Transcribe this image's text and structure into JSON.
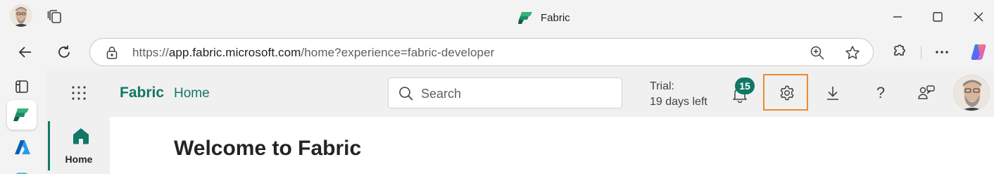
{
  "window": {
    "title": "Fabric",
    "icons": {
      "tabs": "tab-actions-icon",
      "min": "minimize-icon",
      "max": "maximize-icon",
      "close": "close-icon"
    }
  },
  "toolbar": {
    "url_scheme": "https://",
    "url_host": "app.fabric.microsoft.com",
    "url_path": "/home?experience=fabric-developer",
    "icons": [
      "back-icon",
      "reload-icon",
      "lock-icon",
      "zoom-icon",
      "favorite-star-icon",
      "extensions-icon",
      "more-icon",
      "copilot-icon"
    ]
  },
  "browser_sidebar": {
    "items": [
      "panel-icon",
      "fabric-app-icon",
      "azure-icon"
    ]
  },
  "app": {
    "brand": "Fabric",
    "breadcrumb": "Home",
    "search": {
      "placeholder": "Search"
    },
    "trial": {
      "line1": "Trial:",
      "line2": "19 days left"
    },
    "notifications": {
      "count": "15"
    },
    "rail": {
      "home_label": "Home"
    },
    "welcome": "Welcome to Fabric"
  },
  "colors": {
    "accent": "#117865",
    "highlight": "#ec8a33"
  }
}
